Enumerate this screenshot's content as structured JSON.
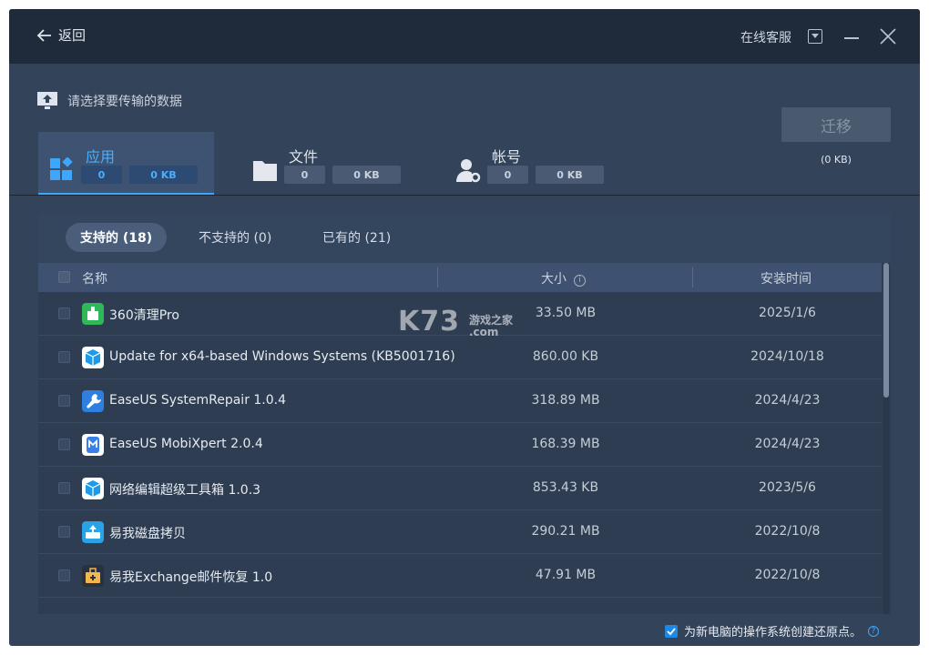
{
  "titlebar": {
    "back_label": "返回",
    "service_label": "在线客服"
  },
  "header": {
    "subtitle": "请选择要传输的数据",
    "categories": [
      {
        "label": "应用",
        "count": "0",
        "size": "0 KB",
        "icon": "apps-icon",
        "active": true
      },
      {
        "label": "文件",
        "count": "0",
        "size": "0 KB",
        "icon": "folder-icon",
        "active": false
      },
      {
        "label": "帐号",
        "count": "0",
        "size": "0 KB",
        "icon": "account-icon",
        "active": false
      }
    ],
    "migrate_label": "迁移",
    "migrate_size": "(0 KB)"
  },
  "tabs": [
    {
      "label": "支持的 (18)",
      "active": true
    },
    {
      "label": "不支持的 (0)",
      "active": false
    },
    {
      "label": "已有的 (21)",
      "active": false
    }
  ],
  "table": {
    "headers": {
      "name": "名称",
      "size": "大小",
      "date": "安装时间"
    },
    "rows": [
      {
        "name": "360清理Pro",
        "size": "33.50 MB",
        "date": "2025/1/6",
        "icon": "cleaner-app-icon",
        "color": "#2fb85a"
      },
      {
        "name": "Update for x64-based Windows Systems (KB5001716)",
        "size": "860.00 KB",
        "date": "2024/10/18",
        "icon": "package-app-icon",
        "color": "#1e9be8"
      },
      {
        "name": "EaseUS SystemRepair 1.0.4",
        "size": "318.89 MB",
        "date": "2024/4/23",
        "icon": "repair-app-icon",
        "color": "#2e7fe0"
      },
      {
        "name": "EaseUS MobiXpert 2.0.4",
        "size": "168.39 MB",
        "date": "2024/4/23",
        "icon": "mobixpert-app-icon",
        "color": "#3b7ee8"
      },
      {
        "name": "网络编辑超级工具箱 1.0.3",
        "size": "853.43 KB",
        "date": "2023/5/6",
        "icon": "package-app-icon",
        "color": "#1e9be8"
      },
      {
        "name": "易我磁盘拷贝",
        "size": "290.21 MB",
        "date": "2022/10/8",
        "icon": "disk-copy-app-icon",
        "color": "#2aa3e6"
      },
      {
        "name": "易我Exchange邮件恢复 1.0",
        "size": "47.91 MB",
        "date": "2022/10/8",
        "icon": "mail-recovery-app-icon",
        "color": "#27313f"
      }
    ]
  },
  "watermark": {
    "main": "K73",
    "sub1": "游戏之家",
    "sub2": ".com"
  },
  "footer": {
    "label": "为新电脑的操作系统创建还原点。",
    "checked": true
  }
}
